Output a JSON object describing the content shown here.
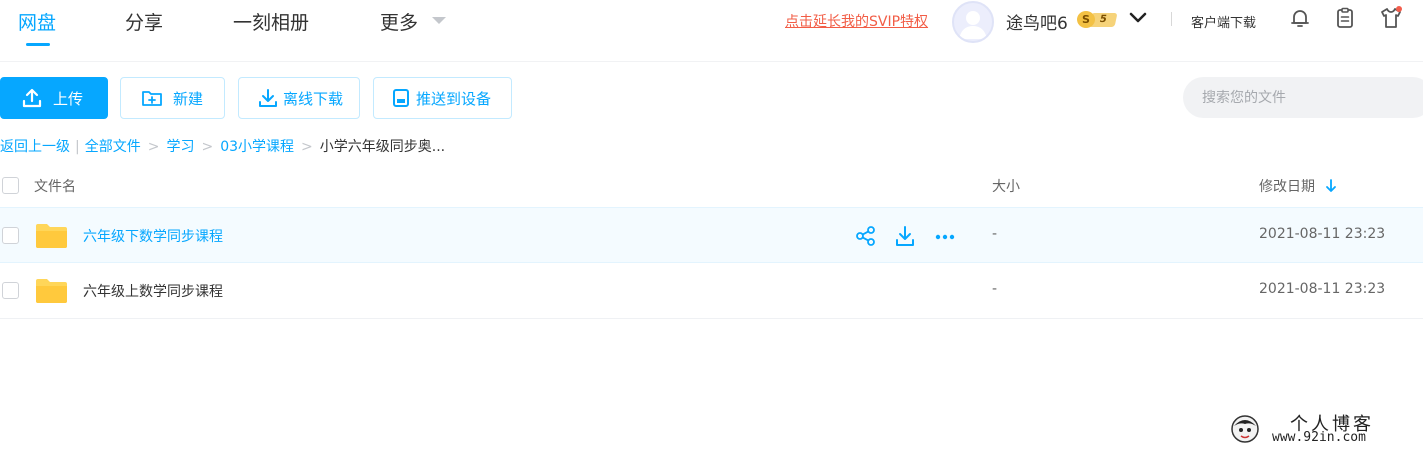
{
  "nav": {
    "tabs": [
      {
        "label": "网盘",
        "active": true
      },
      {
        "label": "分享",
        "active": false
      },
      {
        "label": "一刻相册",
        "active": false
      },
      {
        "label": "更多",
        "active": false
      }
    ],
    "svip_link": "点击延长我的SVIP特权",
    "username": "途鸟吧6",
    "vip_level": "5",
    "vip_coin": "S",
    "client_download": "客户端下载",
    "icons": [
      "user-menu-chevron-icon",
      "bell-icon",
      "clipboard-icon",
      "tshirt-icon"
    ]
  },
  "toolbar": {
    "upload": "上传",
    "new": "新建",
    "offline_download": "离线下载",
    "push_to_device": "推送到设备",
    "search_placeholder": "搜索您的文件"
  },
  "breadcrumb": {
    "back": "返回上一级",
    "items": [
      "全部文件",
      "学习",
      "03小学课程"
    ],
    "current": "小学六年级同步奥..."
  },
  "list": {
    "headers": {
      "name": "文件名",
      "size": "大小",
      "date": "修改日期"
    },
    "sort": "date-desc",
    "rows": [
      {
        "name": "六年级下数学同步课程",
        "size": "-",
        "date": "2021-08-11 23:23",
        "hovered": true
      },
      {
        "name": "六年级上数学同步课程",
        "size": "-",
        "date": "2021-08-11 23:23",
        "hovered": false
      }
    ]
  },
  "watermark": {
    "title": "个人博客",
    "url": "www.92in.com"
  },
  "colors": {
    "accent": "#06a7ff",
    "svip": "#f25d46",
    "folder": "#ffd659"
  }
}
